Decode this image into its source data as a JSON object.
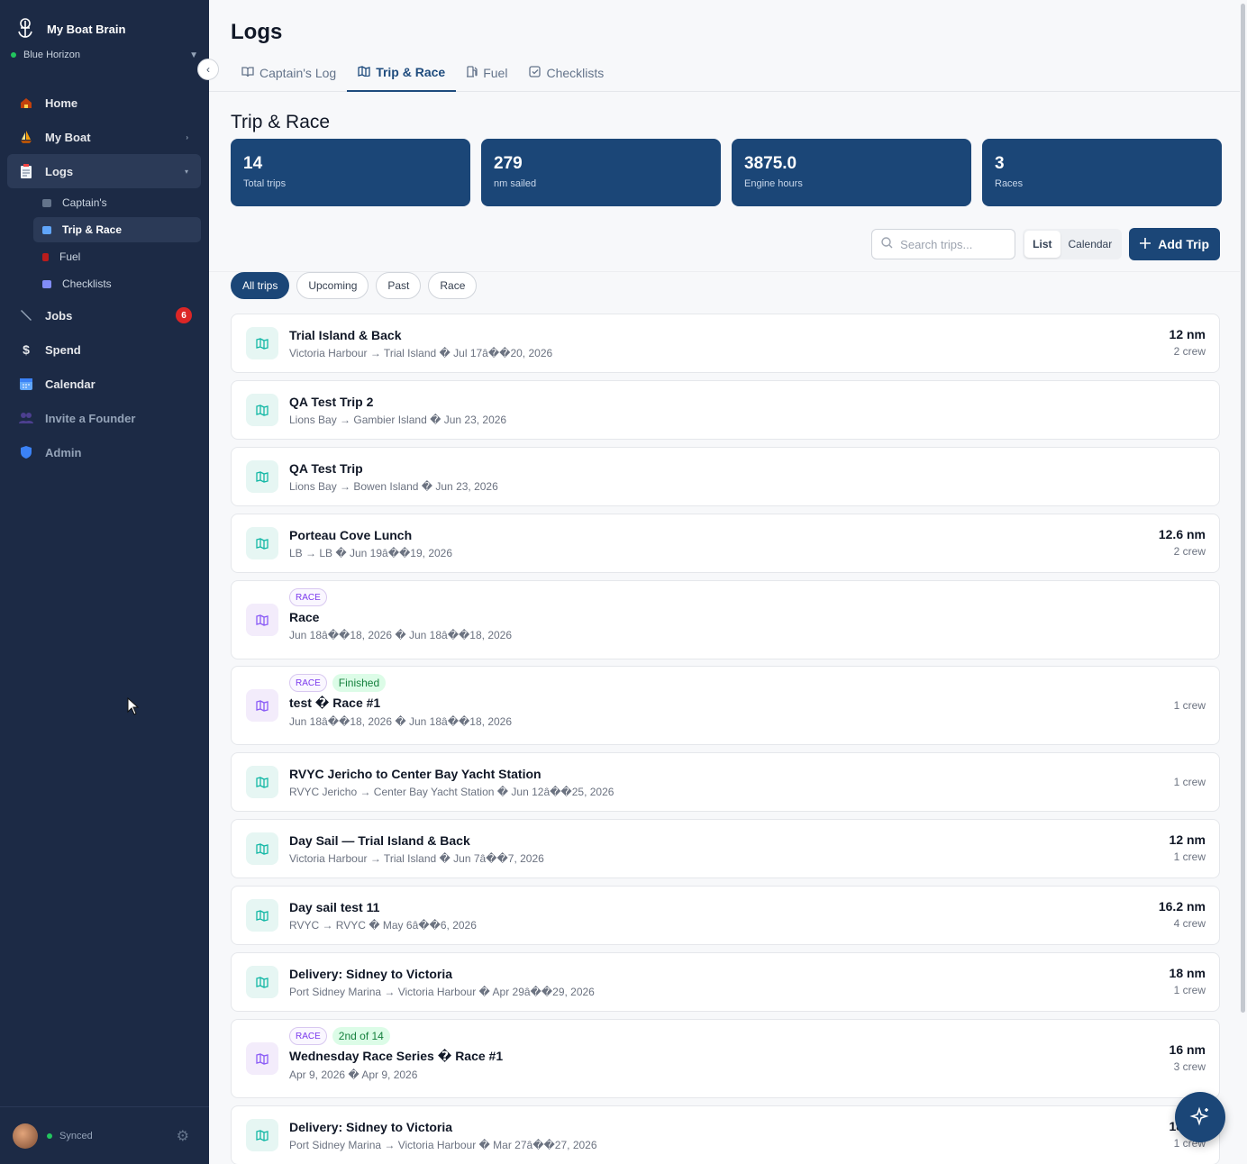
{
  "sidebar": {
    "app_name": "My Boat Brain",
    "boat_name": "Blue Horizon",
    "collapse_glyph": "‹",
    "items": [
      {
        "label": "Home",
        "icon": "house-icon"
      },
      {
        "label": "My Boat",
        "icon": "sailboat-icon"
      },
      {
        "label": "Logs",
        "icon": "clipboard-icon"
      },
      {
        "label": "Jobs",
        "icon": "wrench-icon",
        "badge": "6"
      },
      {
        "label": "Spend",
        "icon": "dollar-icon"
      },
      {
        "label": "Calendar",
        "icon": "calendar-icon"
      },
      {
        "label": "Invite a Founder",
        "icon": "people-icon"
      },
      {
        "label": "Admin",
        "icon": "shield-icon"
      }
    ],
    "logs_sub": [
      {
        "label": "Captain's"
      },
      {
        "label": "Trip & Race"
      },
      {
        "label": "Fuel"
      },
      {
        "label": "Checklists"
      }
    ],
    "sync_status": "Synced"
  },
  "header": {
    "title": "Logs",
    "tabs": [
      {
        "label": "Captain's Log"
      },
      {
        "label": "Trip & Race"
      },
      {
        "label": "Fuel"
      },
      {
        "label": "Checklists"
      }
    ]
  },
  "section_title": "Trip & Race",
  "stats": [
    {
      "value": "14",
      "label": "Total trips"
    },
    {
      "value": "279",
      "label": "nm sailed"
    },
    {
      "value": "3875.0",
      "label": "Engine hours"
    },
    {
      "value": "3",
      "label": "Races"
    }
  ],
  "controls": {
    "search_placeholder": "Search trips...",
    "view_list": "List",
    "view_calendar": "Calendar",
    "add_trip": "Add Trip"
  },
  "filters": [
    "All trips",
    "Upcoming",
    "Past",
    "Race"
  ],
  "trips": [
    {
      "title": "Trial Island & Back",
      "sub": "Victoria Harbour → Trial Island � Jul 17â��20, 2026",
      "nm": "12 nm",
      "crew": "2 crew",
      "kind": "trip",
      "tags": []
    },
    {
      "title": "QA Test Trip 2",
      "sub": "Lions Bay → Gambier Island � Jun 23, 2026",
      "nm": "",
      "crew": "",
      "kind": "trip",
      "tags": []
    },
    {
      "title": "QA Test Trip",
      "sub": "Lions Bay → Bowen Island � Jun 23, 2026",
      "nm": "",
      "crew": "",
      "kind": "trip",
      "tags": []
    },
    {
      "title": "Porteau Cove Lunch",
      "sub": "LB → LB � Jun 19â��19, 2026",
      "nm": "12.6 nm",
      "crew": "2 crew",
      "kind": "trip",
      "tags": []
    },
    {
      "title": "Race",
      "sub": "Jun 18â��18, 2026 � Jun 18â��18, 2026",
      "nm": "",
      "crew": "",
      "kind": "race",
      "tags": [
        "RACE"
      ]
    },
    {
      "title": "test � Race #1",
      "sub": "Jun 18â��18, 2026 � Jun 18â��18, 2026",
      "nm": "",
      "crew": "1 crew",
      "kind": "race",
      "tags": [
        "RACE",
        "Finished"
      ]
    },
    {
      "title": "RVYC Jericho to Center Bay Yacht Station",
      "sub": "RVYC Jericho → Center Bay Yacht Station � Jun 12â��25, 2026",
      "nm": "",
      "crew": "1 crew",
      "kind": "trip",
      "tags": []
    },
    {
      "title": "Day Sail — Trial Island & Back",
      "sub": "Victoria Harbour → Trial Island � Jun 7â��7, 2026",
      "nm": "12 nm",
      "crew": "1 crew",
      "kind": "trip",
      "tags": []
    },
    {
      "title": "Day sail test 11",
      "sub": "RVYC → RVYC � May 6â��6, 2026",
      "nm": "16.2 nm",
      "crew": "4 crew",
      "kind": "trip",
      "tags": []
    },
    {
      "title": "Delivery: Sidney to Victoria",
      "sub": "Port Sidney Marina → Victoria Harbour � Apr 29â��29, 2026",
      "nm": "18 nm",
      "crew": "1 crew",
      "kind": "trip",
      "tags": []
    },
    {
      "title": "Wednesday Race Series � Race #1",
      "sub": "Apr 9, 2026 � Apr 9, 2026",
      "nm": "16 nm",
      "crew": "3 crew",
      "kind": "race",
      "tags": [
        "RACE",
        "2nd of 14"
      ]
    },
    {
      "title": "Delivery: Sidney to Victoria",
      "sub": "Port Sidney Marina → Victoria Harbour � Mar 27â��27, 2026",
      "nm": "18 nm",
      "crew": "1 crew",
      "kind": "trip",
      "tags": []
    }
  ],
  "colors": {
    "navy": "#1b4677",
    "sidebar": "#1c2a45",
    "teal": "#14b8a6",
    "purple": "#8b5cf6",
    "badge_red": "#dc2626"
  }
}
